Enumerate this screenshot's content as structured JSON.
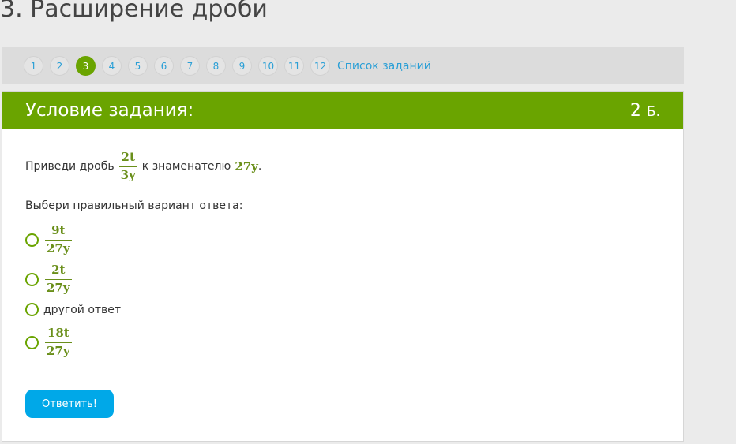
{
  "page_title": "3. Расширение дроби",
  "nav": {
    "items": [
      "1",
      "2",
      "3",
      "4",
      "5",
      "6",
      "7",
      "8",
      "9",
      "10",
      "11",
      "12"
    ],
    "current": "3",
    "list_link": "Список заданий"
  },
  "card": {
    "title": "Условие задания:",
    "points_value": "2",
    "points_unit": "Б."
  },
  "task": {
    "prefix": "Приведи дробь",
    "fraction": {
      "num": "2t",
      "den": "3y"
    },
    "middle": "к знаменателю",
    "target": "27y",
    "suffix": "."
  },
  "choose_prompt": "Выбери правильный вариант ответа:",
  "options": [
    {
      "num": "9t",
      "den": "27y"
    },
    {
      "num": "2t",
      "den": "27y"
    },
    {
      "text": "другой ответ"
    },
    {
      "num": "18t",
      "den": "27y"
    }
  ],
  "submit_label": "Ответить!",
  "colors": {
    "accent": "#6aa400",
    "button": "#00a8e8",
    "link": "#2a9fd6"
  }
}
